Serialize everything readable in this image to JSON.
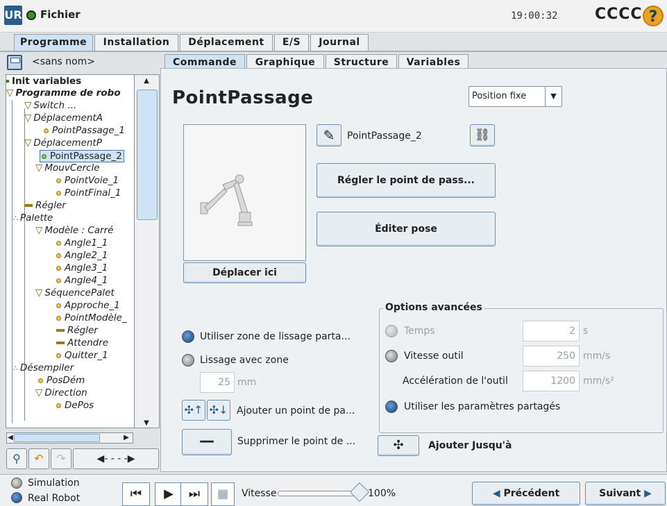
{
  "header": {
    "logo": "UR",
    "file_menu": "Fichier",
    "clock": "19:00:32",
    "robot_name": "CCCC",
    "help": "?"
  },
  "main_tabs": [
    "Programme",
    "Installation",
    "Déplacement",
    "E/S",
    "Journal"
  ],
  "program": {
    "name": "<sans nom>"
  },
  "sub_tabs": [
    "Commande",
    "Graphique",
    "Structure",
    "Variables"
  ],
  "tree": [
    "Init variables",
    "Programme de robo",
    "Switch ...",
    "DéplacementA",
    "PointPassage_1",
    "DéplacementP",
    "PointPassage_2",
    "MouvCercle",
    "PointVoie_1",
    "PointFinal_1",
    "Régler",
    "Palette",
    "Modèle : Carré",
    "Angle1_1",
    "Angle2_1",
    "Angle3_1",
    "Angle4_1",
    "SéquencePalet",
    "Approche_1",
    "PointModèle_",
    "Régler",
    "Attendre",
    "Quitter_1",
    "Désempiler",
    "PosDém",
    "Direction",
    "DePos"
  ],
  "panel": {
    "title": "PointPassage",
    "position_type": "Position fixe",
    "waypoint_name": "PointPassage_2",
    "set_waypoint": "Régler le point de pass...",
    "edit_pose": "Éditer pose",
    "move_here": "Déplacer ici",
    "use_shared_blend": "Utiliser zone de lissage parta...",
    "blend_with_radius": "Lissage avec zone",
    "blend_value": "25",
    "blend_unit": "mm",
    "add_waypoint": "Ajouter un point de pa...",
    "delete_waypoint": "Supprimer le point de ...",
    "add_until": "Ajouter Jusqu'à"
  },
  "advanced": {
    "title": "Options avancées",
    "time_label": "Temps",
    "time_value": "2",
    "time_unit": "s",
    "tool_speed_label": "Vitesse outil",
    "tool_speed_value": "250",
    "tool_speed_unit": "mm/s",
    "tool_accel_label": "Accélération de l'outil",
    "tool_accel_value": "1200",
    "tool_accel_unit": "mm/s²",
    "shared_params_label": "Utiliser les paramètres partagés"
  },
  "footer": {
    "simulation": "Simulation",
    "real_robot": "Real Robot",
    "speed_label": "Vitesse",
    "speed_value": "100%",
    "speed_fraction": 1.0,
    "previous": "Précédent",
    "next": "Suivant"
  },
  "colors": {
    "accent": "#2b5c8a",
    "tab_active": "#cfe3f5",
    "status_ok": "#3a8f2e"
  }
}
